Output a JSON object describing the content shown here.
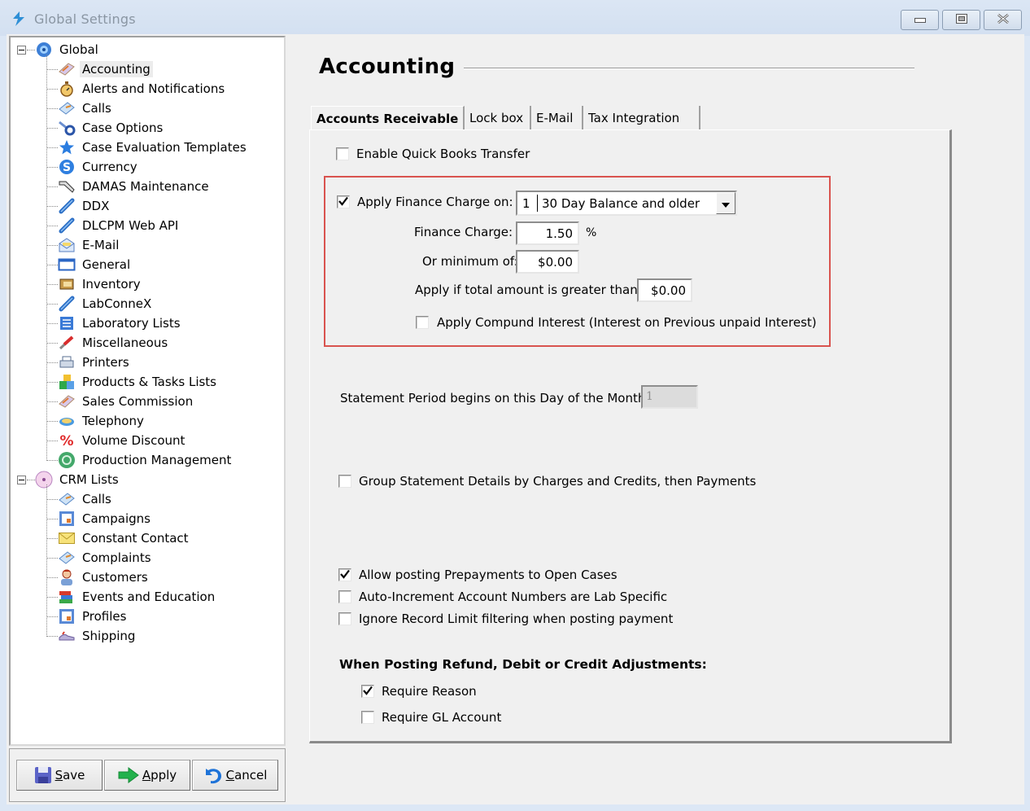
{
  "window": {
    "title": "Global Settings",
    "controls": {
      "minimize": "minimize-icon",
      "maximize": "maximize-icon",
      "close": "close-icon"
    }
  },
  "tree": {
    "groups": [
      {
        "label": "Global",
        "icon": "globe-gear-icon",
        "expanded": true,
        "items": [
          {
            "label": "Accounting",
            "icon": "ledger-icon",
            "selected": true
          },
          {
            "label": "Alerts and Notifications",
            "icon": "stopwatch-icon"
          },
          {
            "label": "Calls",
            "icon": "phone-note-icon"
          },
          {
            "label": "Case Options",
            "icon": "tools-icon"
          },
          {
            "label": "Case Evaluation Templates",
            "icon": "star-icon"
          },
          {
            "label": "Currency",
            "icon": "currency-icon"
          },
          {
            "label": "DAMAS Maintenance",
            "icon": "wrench-icon"
          },
          {
            "label": "DDX",
            "icon": "link-icon"
          },
          {
            "label": "DLCPM Web API",
            "icon": "link-icon"
          },
          {
            "label": "E-Mail",
            "icon": "envelope-open-icon"
          },
          {
            "label": "General",
            "icon": "window-icon"
          },
          {
            "label": "Inventory",
            "icon": "box-icon"
          },
          {
            "label": "LabConneX",
            "icon": "link-icon"
          },
          {
            "label": "Laboratory Lists",
            "icon": "list-icon"
          },
          {
            "label": "Miscellaneous",
            "icon": "knife-icon"
          },
          {
            "label": "Printers",
            "icon": "printer-icon"
          },
          {
            "label": "Products & Tasks Lists",
            "icon": "blocks-icon"
          },
          {
            "label": "Sales Commission",
            "icon": "ledger-icon"
          },
          {
            "label": "Telephony",
            "icon": "telephone-icon"
          },
          {
            "label": "Volume Discount",
            "icon": "percent-icon"
          },
          {
            "label": "Production Management",
            "icon": "recycle-icon"
          }
        ]
      },
      {
        "label": "CRM Lists",
        "icon": "disc-icon",
        "expanded": true,
        "items": [
          {
            "label": "Calls",
            "icon": "phone-note-icon"
          },
          {
            "label": "Campaigns",
            "icon": "campaign-icon"
          },
          {
            "label": "Constant Contact",
            "icon": "envelope-icon"
          },
          {
            "label": "Complaints",
            "icon": "phone-note-icon"
          },
          {
            "label": "Customers",
            "icon": "person-icon"
          },
          {
            "label": "Events and Education",
            "icon": "books-icon"
          },
          {
            "label": "Profiles",
            "icon": "campaign-icon"
          },
          {
            "label": "Shipping",
            "icon": "shoe-icon"
          }
        ]
      }
    ]
  },
  "buttons": {
    "save": {
      "label": "Save",
      "mnemonic": "S",
      "rest": "ave"
    },
    "apply": {
      "label": "Apply",
      "mnemonic": "A",
      "rest": "pply"
    },
    "cancel": {
      "label": "Cancel",
      "mnemonic": "C",
      "rest": "ancel"
    }
  },
  "main": {
    "heading": "Accounting",
    "tabs": [
      {
        "label": "Accounts Receivable",
        "active": true
      },
      {
        "label": "Lock box"
      },
      {
        "label": "E-Mail"
      },
      {
        "label": "Tax Integration"
      }
    ],
    "enable_quickbooks": {
      "label": "Enable Quick Books Transfer",
      "checked": false
    },
    "finance": {
      "apply_on": {
        "label": "Apply Finance Charge on:",
        "checked": true
      },
      "apply_on_select": {
        "code": "1",
        "text": "30 Day Balance and older"
      },
      "charge": {
        "label": "Finance Charge:",
        "value": "1.50",
        "unit": "%"
      },
      "minimum": {
        "label": "Or minimum of:",
        "value": "$0.00"
      },
      "threshold": {
        "label": "Apply if total amount is greater than:",
        "value": "$0.00"
      },
      "compound": {
        "label": "Apply Compund Interest (Interest on  Previous unpaid Interest)",
        "checked": false
      }
    },
    "statement_period": {
      "label": "Statement Period begins on this Day of the Month:",
      "value": "1"
    },
    "group_statement": {
      "label": "Group Statement Details by Charges and Credits, then Payments",
      "checked": false
    },
    "allow_prepayments": {
      "label": "Allow posting Prepayments to Open Cases",
      "checked": true
    },
    "auto_increment": {
      "label": "Auto-Increment Account Numbers are Lab Specific",
      "checked": false
    },
    "ignore_record_limit": {
      "label": "Ignore Record Limit filtering when posting payment",
      "checked": false
    },
    "adjustments": {
      "heading": "When Posting Refund, Debit or Credit Adjustments:",
      "require_reason": {
        "label": "Require Reason",
        "checked": true
      },
      "require_gl": {
        "label": "Require GL Account",
        "checked": false
      }
    }
  }
}
